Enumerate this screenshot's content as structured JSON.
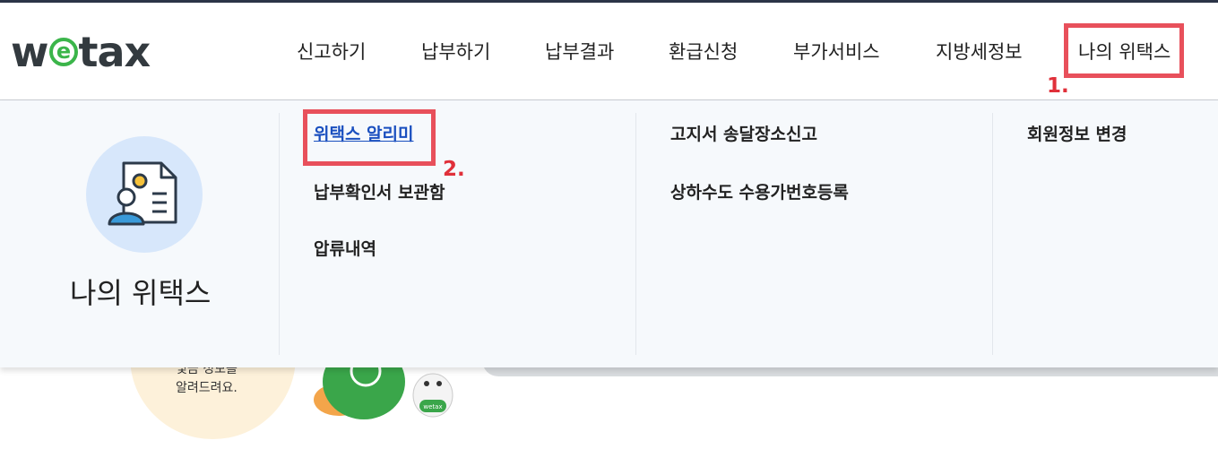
{
  "logo": {
    "text_w": "w",
    "text_e": "e",
    "text_tax": "tax"
  },
  "nav": {
    "items": [
      {
        "label": "신고하기"
      },
      {
        "label": "납부하기"
      },
      {
        "label": "납부결과"
      },
      {
        "label": "환급신청"
      },
      {
        "label": "부가서비스"
      },
      {
        "label": "지방세정보"
      },
      {
        "label": "나의 위택스"
      }
    ]
  },
  "annotations": {
    "step1": "1.",
    "step2": "2."
  },
  "panel": {
    "title": "나의 위택스",
    "col1": [
      {
        "label": "위택스 알리미"
      },
      {
        "label": "납부확인서 보관함"
      },
      {
        "label": "압류내역"
      }
    ],
    "col2": [
      {
        "label": "고지서 송달장소신고"
      },
      {
        "label": "상하수도 수용가번호등록"
      }
    ],
    "col3": [
      {
        "label": "회원정보 변경"
      }
    ]
  },
  "background": {
    "partial_text_line1": "및금 정보를",
    "partial_text_line2": "알려드려요.",
    "mascot_badge": "wetax"
  },
  "colors": {
    "accent_green": "#3bb54a",
    "highlight_red": "#e8505b",
    "link_blue": "#1a4fbf",
    "panel_bg": "#f6f9fc"
  }
}
